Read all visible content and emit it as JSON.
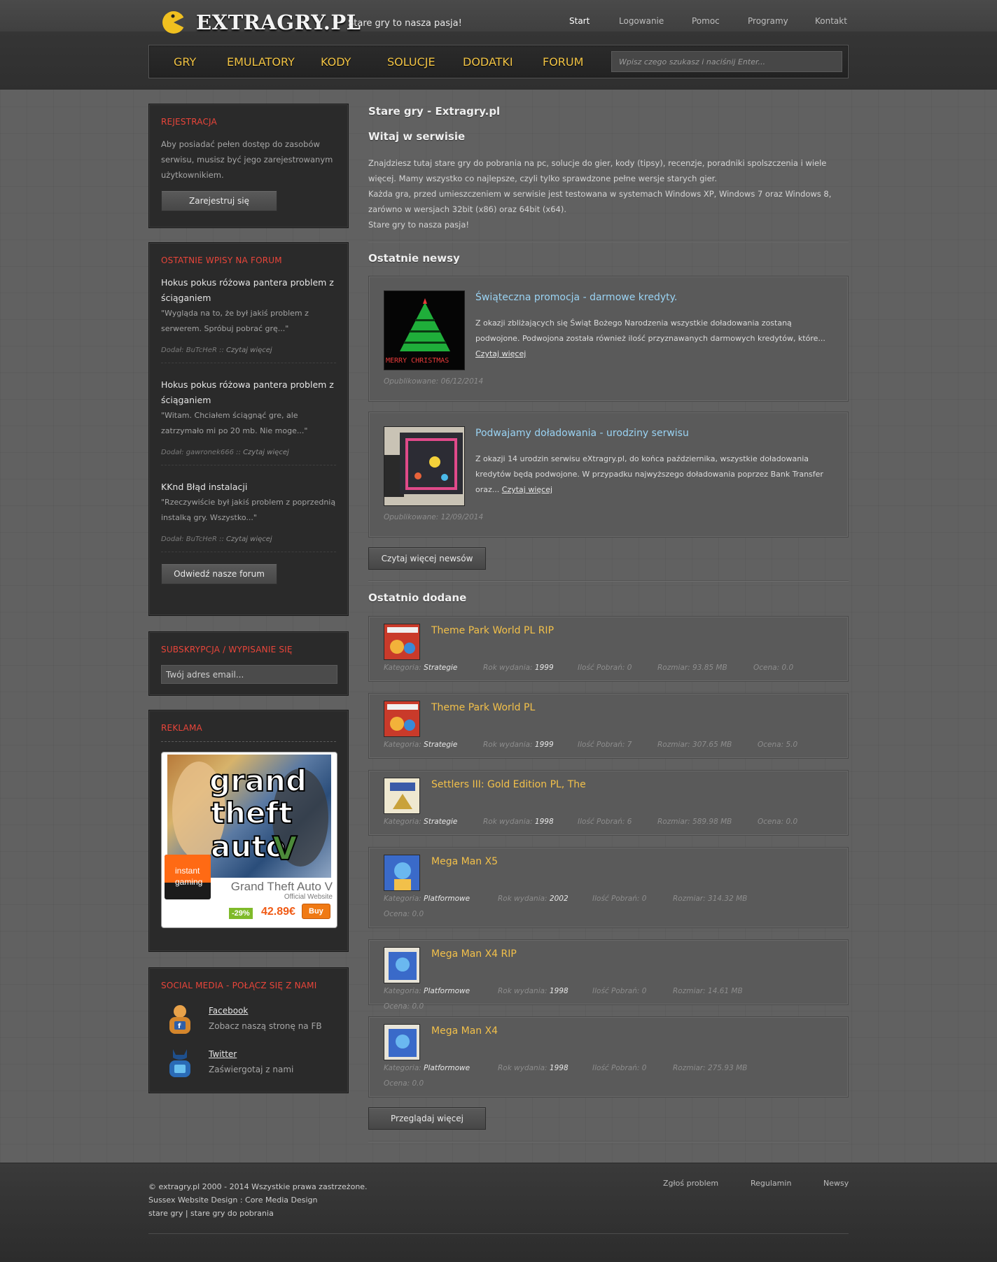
{
  "header": {
    "logo_text": "EXTRAGRY.PL",
    "tagline": "Stare gry to nasza pasja!",
    "topnav": [
      "Start",
      "Logowanie",
      "Pomoc",
      "Programy",
      "Kontakt"
    ],
    "mainnav": [
      "GRY",
      "EMULATORY",
      "KODY",
      "SOLUCJE",
      "DODATKI",
      "FORUM"
    ],
    "search_placeholder": "Wpisz czego szukasz i naciśnij Enter..."
  },
  "sidebar": {
    "register": {
      "title": "REJESTRACJA",
      "text": "Aby posiadać pełen dostęp do zasobów serwisu, musisz być jego zarejestrowanym użytkownikiem.",
      "button": "Zarejestruj się"
    },
    "forum": {
      "title": "OSTATNIE WPISY NA FORUM",
      "posts": [
        {
          "title": "Hokus pokus różowa pantera problem z ściąganiem",
          "excerpt": "\"Wygląda na to, że był jakiś problem z serwerem. Spróbuj pobrać grę...\"",
          "meta": "Dodał: BuTcHeR :: ",
          "link": "Czytaj więcej"
        },
        {
          "title": "Hokus pokus różowa pantera problem z ściąganiem",
          "excerpt": "\"Witam. Chciałem ściągnąć gre, ale zatrzymało mi po 20 mb. Nie moge...\"",
          "meta": "Dodał: gawronek666 :: ",
          "link": "Czytaj więcej"
        },
        {
          "title": "KKnd Błąd instalacji",
          "excerpt": "\"Rzeczywiście był jakiś problem z poprzednią instalką gry. Wszystko...\"",
          "meta": "Dodał: BuTcHeR :: ",
          "link": "Czytaj więcej"
        }
      ],
      "button": "Odwiedź nasze forum"
    },
    "newsletter": {
      "title": "SUBSKRYPCJA / WYPISANIE SIĘ",
      "placeholder": "Twój adres email..."
    },
    "ad": {
      "title": "REKLAMA",
      "logo_line1": "instant",
      "logo_line2": "gaming",
      "game": "Grand Theft Auto V",
      "sub": "Official Website",
      "discount": "-29%",
      "price": "42.89€",
      "buy": "Buy"
    },
    "social": {
      "title": "SOCIAL MEDIA - POŁĄCZ SIĘ Z NAMI",
      "items": [
        {
          "name": "Facebook",
          "desc": "Zobacz naszą stronę na FB"
        },
        {
          "name": "Twitter",
          "desc": "Zaświergotaj z nami"
        }
      ]
    }
  },
  "main": {
    "page_title": "Stare gry - Extragry.pl",
    "welcome_title": "Witaj w serwisie",
    "intro": [
      "Znajdziesz tutaj stare gry do pobrania na pc, solucje do gier, kody (tipsy), recenzje, poradniki spolszczenia i wiele więcej. Mamy wszystko co najlepsze, czyli tylko sprawdzone pełne wersje starych gier.",
      "Każda gra, przed umieszczeniem w serwisie jest testowana w systemach Windows XP, Windows 7 oraz Windows 8, zarówno w wersjach 32bit (x86) oraz 64bit (x64).",
      "Stare gry to nasza pasja!"
    ],
    "news_title": "Ostatnie newsy",
    "news": [
      {
        "title": "Świąteczna promocja - darmowe kredyty.",
        "body": "Z okazji zbliżających się Świąt Bożego Narodzenia wszystkie doładowania zostaną podwojone. Podwojona została również ilość przyznawanych darmowych kredytów, które... ",
        "link": "Czytaj więcej",
        "date": "Opublikowane: 06/12/2014",
        "thumb_text": "MERRY CHRISTMAS"
      },
      {
        "title": "Podwajamy doładowania - urodziny serwisu",
        "body": "Z okazji 14 urodzin serwisu eXtragry.pl, do końca października, wszystkie doładowania kredytów będą podwojone. W przypadku najwyższego doładowania poprzez Bank Transfer oraz... ",
        "link": "Czytaj więcej",
        "date": "Opublikowane: 12/09/2014"
      }
    ],
    "more_news_button": "Czytaj więcej newsów",
    "recent_title": "Ostatnio dodane",
    "labels": {
      "category": "Kategoria: ",
      "year": "Rok wydania: ",
      "downloads": "Ilość Pobrań: ",
      "size": "Rozmiar: ",
      "rating": "Ocena: "
    },
    "games": [
      {
        "title": "Theme Park World PL RIP",
        "category": "Strategie",
        "year": "1999",
        "downloads": "0",
        "size": "93.85 MB",
        "rating": "0.0"
      },
      {
        "title": "Theme Park World PL",
        "category": "Strategie",
        "year": "1999",
        "downloads": "7",
        "size": "307.65 MB",
        "rating": "5.0"
      },
      {
        "title": "Settlers III: Gold Edition PL, The",
        "category": "Strategie",
        "year": "1998",
        "downloads": "6",
        "size": "589.98 MB",
        "rating": "0.0"
      },
      {
        "title": "Mega Man X5",
        "category": "Platformowe",
        "year": "2002",
        "downloads": "0",
        "size": "314.32 MB",
        "rating": "0.0"
      },
      {
        "title": "Mega Man X4 RIP",
        "category": "Platformowe",
        "year": "1998",
        "downloads": "0",
        "size": "14.61 MB",
        "rating": "0.0"
      },
      {
        "title": "Mega Man X4",
        "category": "Platformowe",
        "year": "1998",
        "downloads": "0",
        "size": "275.93 MB",
        "rating": "0.0"
      }
    ],
    "browse_more_button": "Przeglądaj więcej"
  },
  "footer": {
    "lines": [
      "© extragry.pl 2000 - 2014 Wszystkie prawa zastrzeżone.",
      "Sussex Website Design : Core Media Design",
      "stare gry | stare gry do pobrania"
    ],
    "links": [
      "Zgłoś problem",
      "Regulamin",
      "Newsy"
    ]
  }
}
